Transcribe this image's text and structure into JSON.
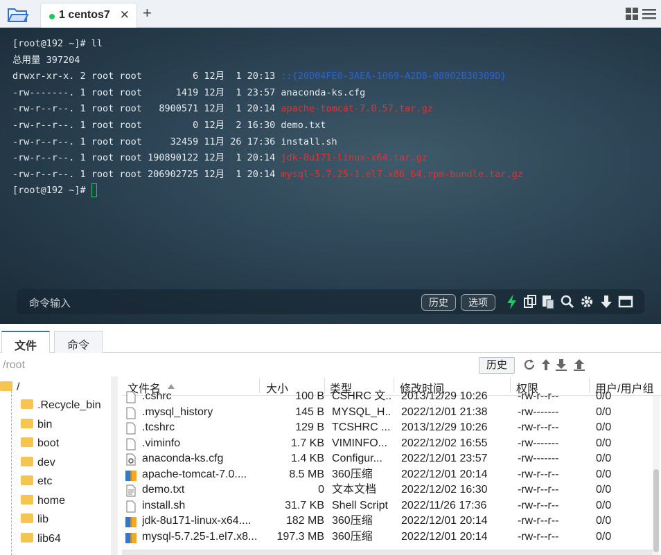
{
  "tabbar": {
    "tab_label": "1 centos7",
    "close_glyph": "✕",
    "add_glyph": "+"
  },
  "terminal": {
    "lines": [
      [
        {
          "t": "[root@192 ~]# ll",
          "c": "#e8ecef"
        }
      ],
      [
        {
          "t": "总用量 397204",
          "c": "#e8ecef"
        }
      ],
      [
        {
          "t": "drwxr-xr-x. 2 root root         6 12月  1 20:13 ",
          "c": "#e8ecef"
        },
        {
          "t": "::{20D04FE0-3AEA-1069-A2D8-08002B30309D}",
          "c": "#2b63d6"
        }
      ],
      [
        {
          "t": "-rw-------. 1 root root      1419 12月  1 23:57 anaconda-ks.cfg",
          "c": "#e8ecef"
        }
      ],
      [
        {
          "t": "-rw-r--r--. 1 root root   8900571 12月  1 20:14 ",
          "c": "#e8ecef"
        },
        {
          "t": "apache-tomcat-7.0.57.tar.gz",
          "c": "#e23232"
        }
      ],
      [
        {
          "t": "-rw-r--r--. 1 root root         0 12月  2 16:30 demo.txt",
          "c": "#e8ecef"
        }
      ],
      [
        {
          "t": "-rw-r--r--. 1 root root     32459 11月 26 17:36 install.sh",
          "c": "#e8ecef"
        }
      ],
      [
        {
          "t": "-rw-r--r--. 1 root root 190890122 12月  1 20:14 ",
          "c": "#e8ecef"
        },
        {
          "t": "jdk-8u171-linux-x64.tar.gz",
          "c": "#e23232"
        }
      ],
      [
        {
          "t": "-rw-r--r--. 1 root root 206902725 12月  1 20:14 ",
          "c": "#e8ecef"
        },
        {
          "t": "mysql-5.7.25-1.el7.x86_64.rpm-bundle.tar.gz",
          "c": "#e23232"
        }
      ]
    ],
    "prompt": "[root@192 ~]# ",
    "cmd_placeholder": "命令输入",
    "history_btn": "历史",
    "options_btn": "选项"
  },
  "panel": {
    "tab_files": "文件",
    "tab_commands": "命令",
    "path": "/root",
    "history_btn": "历史"
  },
  "tree": {
    "root": "/",
    "items": [
      ".Recycle_bin",
      "bin",
      "boot",
      "dev",
      "etc",
      "home",
      "lib",
      "lib64"
    ]
  },
  "files": {
    "headers": {
      "name": "文件名",
      "size": "大小",
      "type": "类型",
      "modified": "修改时间",
      "perm": "权限",
      "owner": "用户/用户组"
    },
    "rows": [
      {
        "name": ".cshrc",
        "size": "100 B",
        "type": "CSHRC 文...",
        "modified": "2013/12/29 10:26",
        "perm": "-rw-r--r--",
        "owner": "0/0",
        "icon": "file"
      },
      {
        "name": ".mysql_history",
        "size": "145 B",
        "type": "MYSQL_H...",
        "modified": "2022/12/01 21:38",
        "perm": "-rw-------",
        "owner": "0/0",
        "icon": "file"
      },
      {
        "name": ".tcshrc",
        "size": "129 B",
        "type": "TCSHRC ...",
        "modified": "2013/12/29 10:26",
        "perm": "-rw-r--r--",
        "owner": "0/0",
        "icon": "file"
      },
      {
        "name": ".viminfo",
        "size": "1.7 KB",
        "type": "VIMINFO...",
        "modified": "2022/12/02 16:55",
        "perm": "-rw-------",
        "owner": "0/0",
        "icon": "file"
      },
      {
        "name": "anaconda-ks.cfg",
        "size": "1.4 KB",
        "type": "Configur...",
        "modified": "2022/12/01 23:57",
        "perm": "-rw-------",
        "owner": "0/0",
        "icon": "config"
      },
      {
        "name": "apache-tomcat-7.0....",
        "size": "8.5 MB",
        "type": "360压缩",
        "modified": "2022/12/01 20:14",
        "perm": "-rw-r--r--",
        "owner": "0/0",
        "icon": "archive"
      },
      {
        "name": "demo.txt",
        "size": "0",
        "type": "文本文档",
        "modified": "2022/12/02 16:30",
        "perm": "-rw-r--r--",
        "owner": "0/0",
        "icon": "text"
      },
      {
        "name": "install.sh",
        "size": "31.7 KB",
        "type": "Shell Script",
        "modified": "2022/11/26 17:36",
        "perm": "-rw-r--r--",
        "owner": "0/0",
        "icon": "file"
      },
      {
        "name": "jdk-8u171-linux-x64....",
        "size": "182 MB",
        "type": "360压缩",
        "modified": "2022/12/01 20:14",
        "perm": "-rw-r--r--",
        "owner": "0/0",
        "icon": "archive"
      },
      {
        "name": "mysql-5.7.25-1.el7.x8...",
        "size": "197.3 MB",
        "type": "360压缩",
        "modified": "2022/12/01 20:14",
        "perm": "-rw-r--r--",
        "owner": "0/0",
        "icon": "archive"
      }
    ]
  }
}
